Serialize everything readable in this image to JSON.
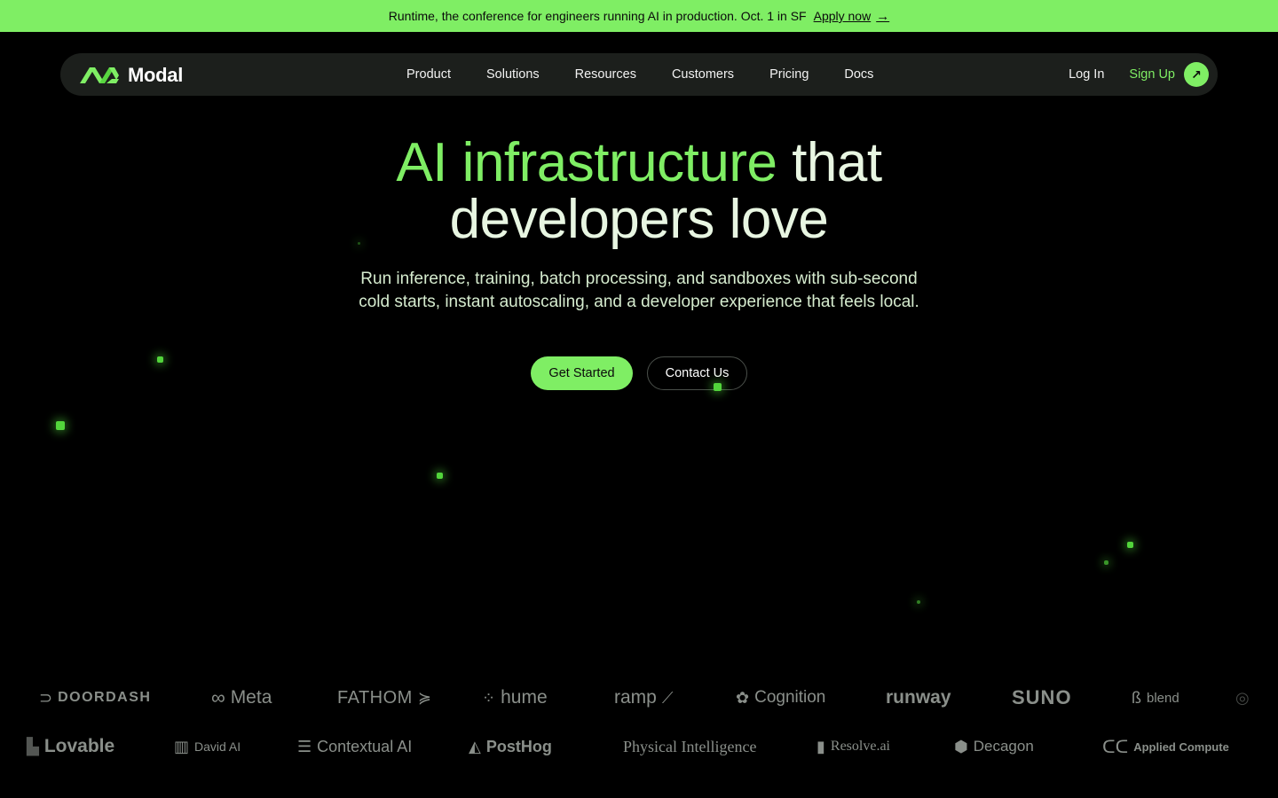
{
  "banner": {
    "text": "Runtime, the conference for engineers running AI in production. Oct. 1 in SF",
    "link_label": "Apply now",
    "arrow_icon": "→"
  },
  "nav": {
    "brand": "Modal",
    "links": [
      "Product",
      "Solutions",
      "Resources",
      "Customers",
      "Pricing",
      "Docs"
    ],
    "login": "Log In",
    "signup": "Sign Up",
    "signup_icon": "↗"
  },
  "hero": {
    "title_accent": "AI infrastructure",
    "title_rest_1": "that",
    "title_line_2": "developers love",
    "subtitle": "Run inference, training, batch processing, and sandboxes with sub-second cold starts, instant autoscaling, and a developer experience that feels local.",
    "primary_cta": "Get Started",
    "secondary_cta": "Contact Us"
  },
  "logos_row_1": [
    "DOORDASH",
    "Meta",
    "FATHOM",
    "hume",
    "ramp",
    "Cognition",
    "runway",
    "SUNO",
    "blend"
  ],
  "logos_row_2": [
    "Lovable",
    "David AI",
    "Contextual AI",
    "PostHog",
    "Physical Intelligence",
    "Resolve.ai",
    "Decagon",
    "Applied Compute"
  ],
  "colors": {
    "accent": "#7fee64",
    "background": "#000000",
    "nav_background": "#1c1f1c",
    "logo_gray": "#8a8f8a"
  }
}
